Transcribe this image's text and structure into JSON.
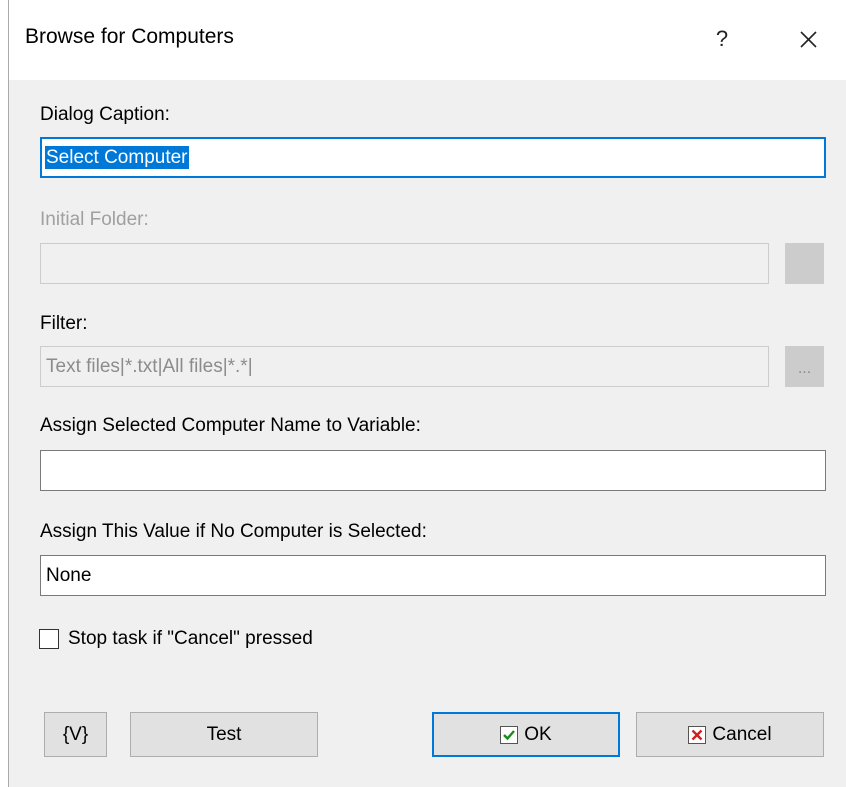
{
  "window": {
    "title": "Browse for Computers",
    "help_glyph": "?",
    "close_icon": "close-icon"
  },
  "dialog_caption": {
    "label": "Dialog Caption:",
    "value": "Select Computer"
  },
  "initial_folder": {
    "label": "Initial Folder:",
    "value": "",
    "enabled": false
  },
  "filter": {
    "label": "Filter:",
    "value": "Text files|*.txt|All files|*.*|",
    "browse_label": "...",
    "enabled": false
  },
  "assign_variable": {
    "label": "Assign Selected Computer Name to Variable:",
    "value": ""
  },
  "default_value": {
    "label": "Assign This Value if No Computer is Selected:",
    "value": "None"
  },
  "stop_task": {
    "label": "Stop task if \"Cancel\" pressed",
    "checked": false
  },
  "buttons": {
    "variables": "{V}",
    "test": "Test",
    "ok": "OK",
    "cancel": "Cancel"
  },
  "colors": {
    "accent": "#0078d7",
    "ok_check": "#1a8a1a",
    "cancel_x": "#d01f1f"
  }
}
